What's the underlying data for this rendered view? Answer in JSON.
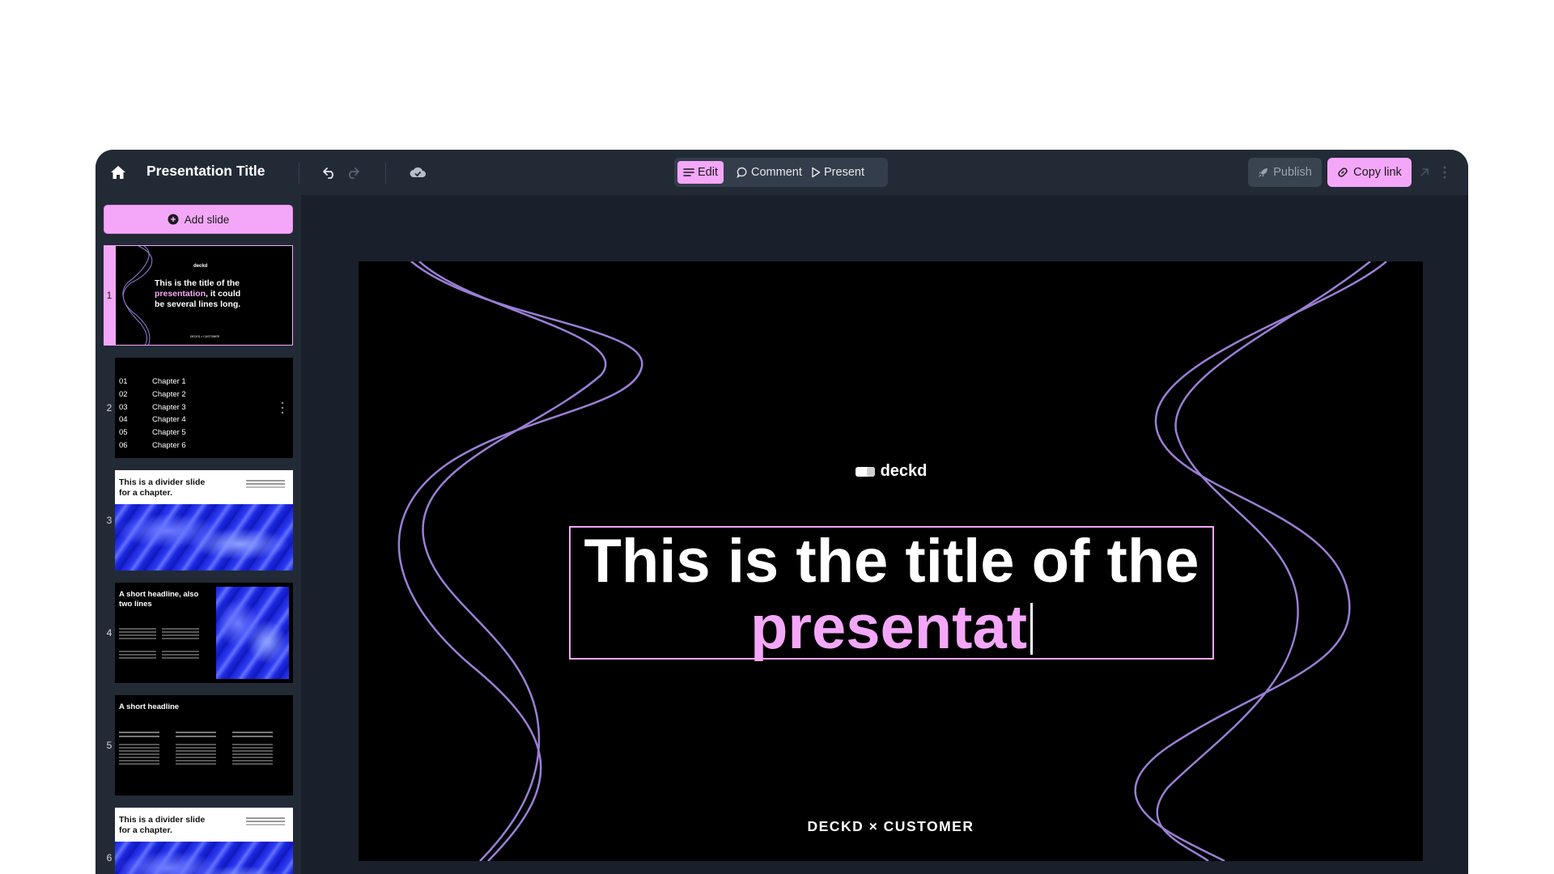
{
  "topbar": {
    "title": "Presentation Title",
    "modes": [
      {
        "label": "Edit",
        "icon": "lines-icon",
        "active": true
      },
      {
        "label": "Comment",
        "icon": "speech-bubble-icon",
        "active": false
      },
      {
        "label": "Present",
        "icon": "play-icon",
        "active": false
      }
    ],
    "publish_label": "Publish",
    "copy_link_label": "Copy link"
  },
  "sidebar": {
    "add_slide_label": "Add slide",
    "slides": [
      {
        "number": "1",
        "brand": "deckd",
        "title_a": "This is the title of the",
        "title_hl": "presentation",
        "title_b": ", it could",
        "title_c": "be several lines long.",
        "footer": "DECKD × CUSTOMER"
      },
      {
        "number": "2",
        "chapters": [
          {
            "n": "01",
            "label": "Chapter 1"
          },
          {
            "n": "02",
            "label": "Chapter 2"
          },
          {
            "n": "03",
            "label": "Chapter 3"
          },
          {
            "n": "04",
            "label": "Chapter 4"
          },
          {
            "n": "05",
            "label": "Chapter 5"
          },
          {
            "n": "06",
            "label": "Chapter 6"
          }
        ]
      },
      {
        "number": "3",
        "heading_1": "This is a divider slide",
        "heading_2": "for a chapter."
      },
      {
        "number": "4",
        "heading_1": "A short headline, also",
        "heading_2": "two lines"
      },
      {
        "number": "5",
        "heading_1": "A short headline"
      },
      {
        "number": "6",
        "heading_1": "This is a divider slide",
        "heading_2": "for a chapter."
      }
    ]
  },
  "slide": {
    "brand": "deckd",
    "title_line1": "This is the title of the",
    "title_line2": "presentat",
    "footer": "DECKD × CUSTOMER"
  },
  "colors": {
    "accent": "#f4a7f8",
    "app_bg": "#1a202b",
    "panel_bg": "#222a36",
    "curve": "#9b7fd6"
  }
}
